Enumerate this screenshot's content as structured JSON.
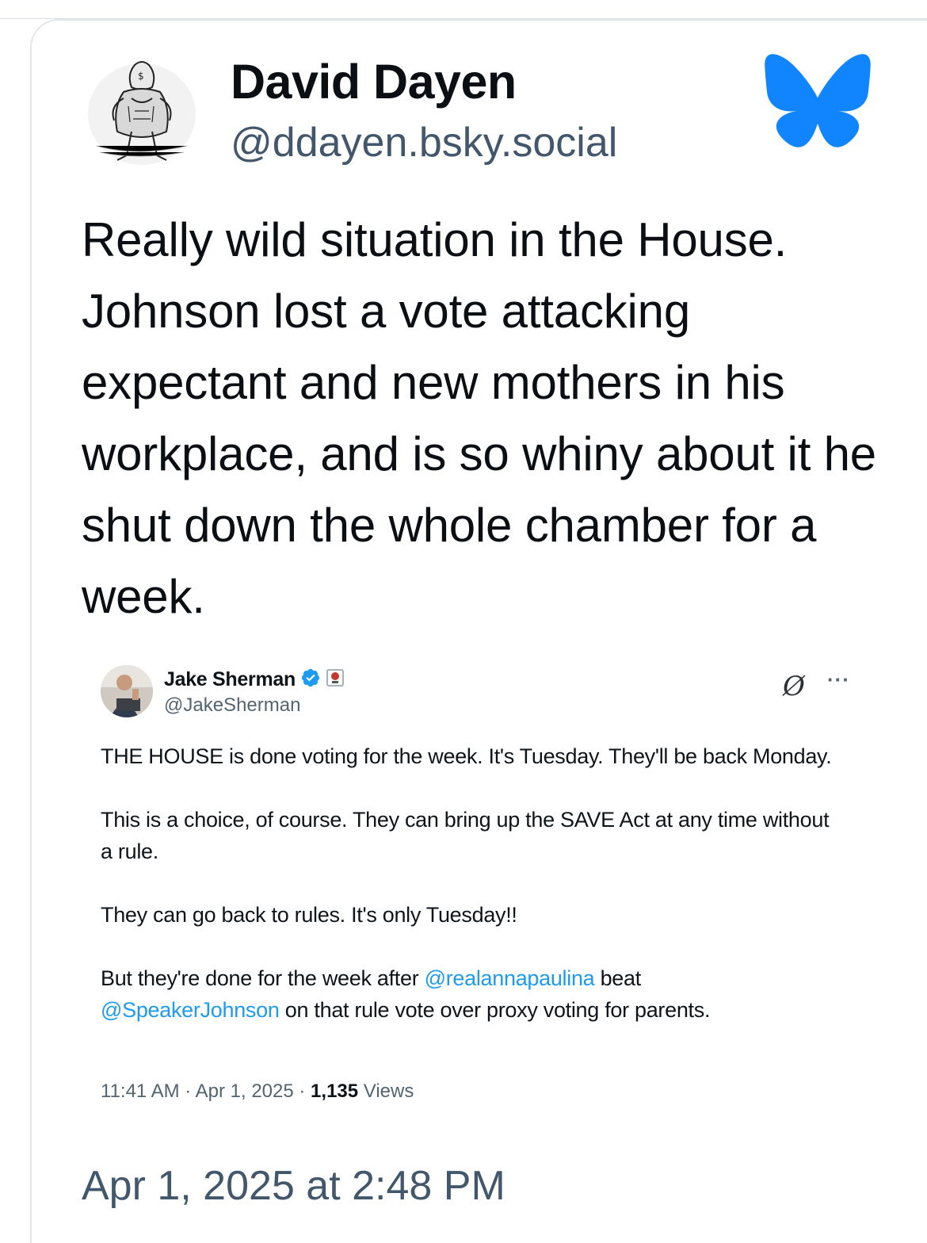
{
  "post": {
    "author_name": "David Dayen",
    "author_handle": "@ddayen.bsky.social",
    "text": "Really wild situation in the House. Johnson lost a vote attacking expectant and new mothers in his workplace, and is so whiny about it he shut down the whole chamber for a week.",
    "timestamp": "Apr 1, 2025 at 2:48 PM"
  },
  "embed": {
    "author_name": "Jake Sherman",
    "author_handle": "@JakeSherman",
    "paragraphs": {
      "p1": "THE HOUSE is done voting for the week. It's Tuesday. They'll be back Monday.",
      "p2": "This is a choice, of course. They can bring up the SAVE Act at any time without a rule.",
      "p3": "They can go back to rules. It's only Tuesday!!",
      "p4_before": "But they're done for the week after",
      "p4_mention1": "@realannapaulina",
      "p4_mid": "beat",
      "p4_mention2": "@SpeakerJohnson",
      "p4_after": "on that rule vote over proxy voting for parents."
    },
    "meta_time": "11:41 AM · Apr 1, 2025 · ",
    "meta_views_count": "1,135",
    "meta_views_label": " Views",
    "more_label": "···",
    "grok_icon_glyph": "Ø"
  },
  "colors": {
    "bluesky": "#1185fe",
    "verified": "#1d9bf0",
    "mention": "#1d9bf0",
    "secondary_text": "#42576c"
  },
  "icons": [
    "bluesky-butterfly-icon",
    "verified-badge-icon",
    "affiliate-badge-icon",
    "grok-icon",
    "more-icon"
  ]
}
